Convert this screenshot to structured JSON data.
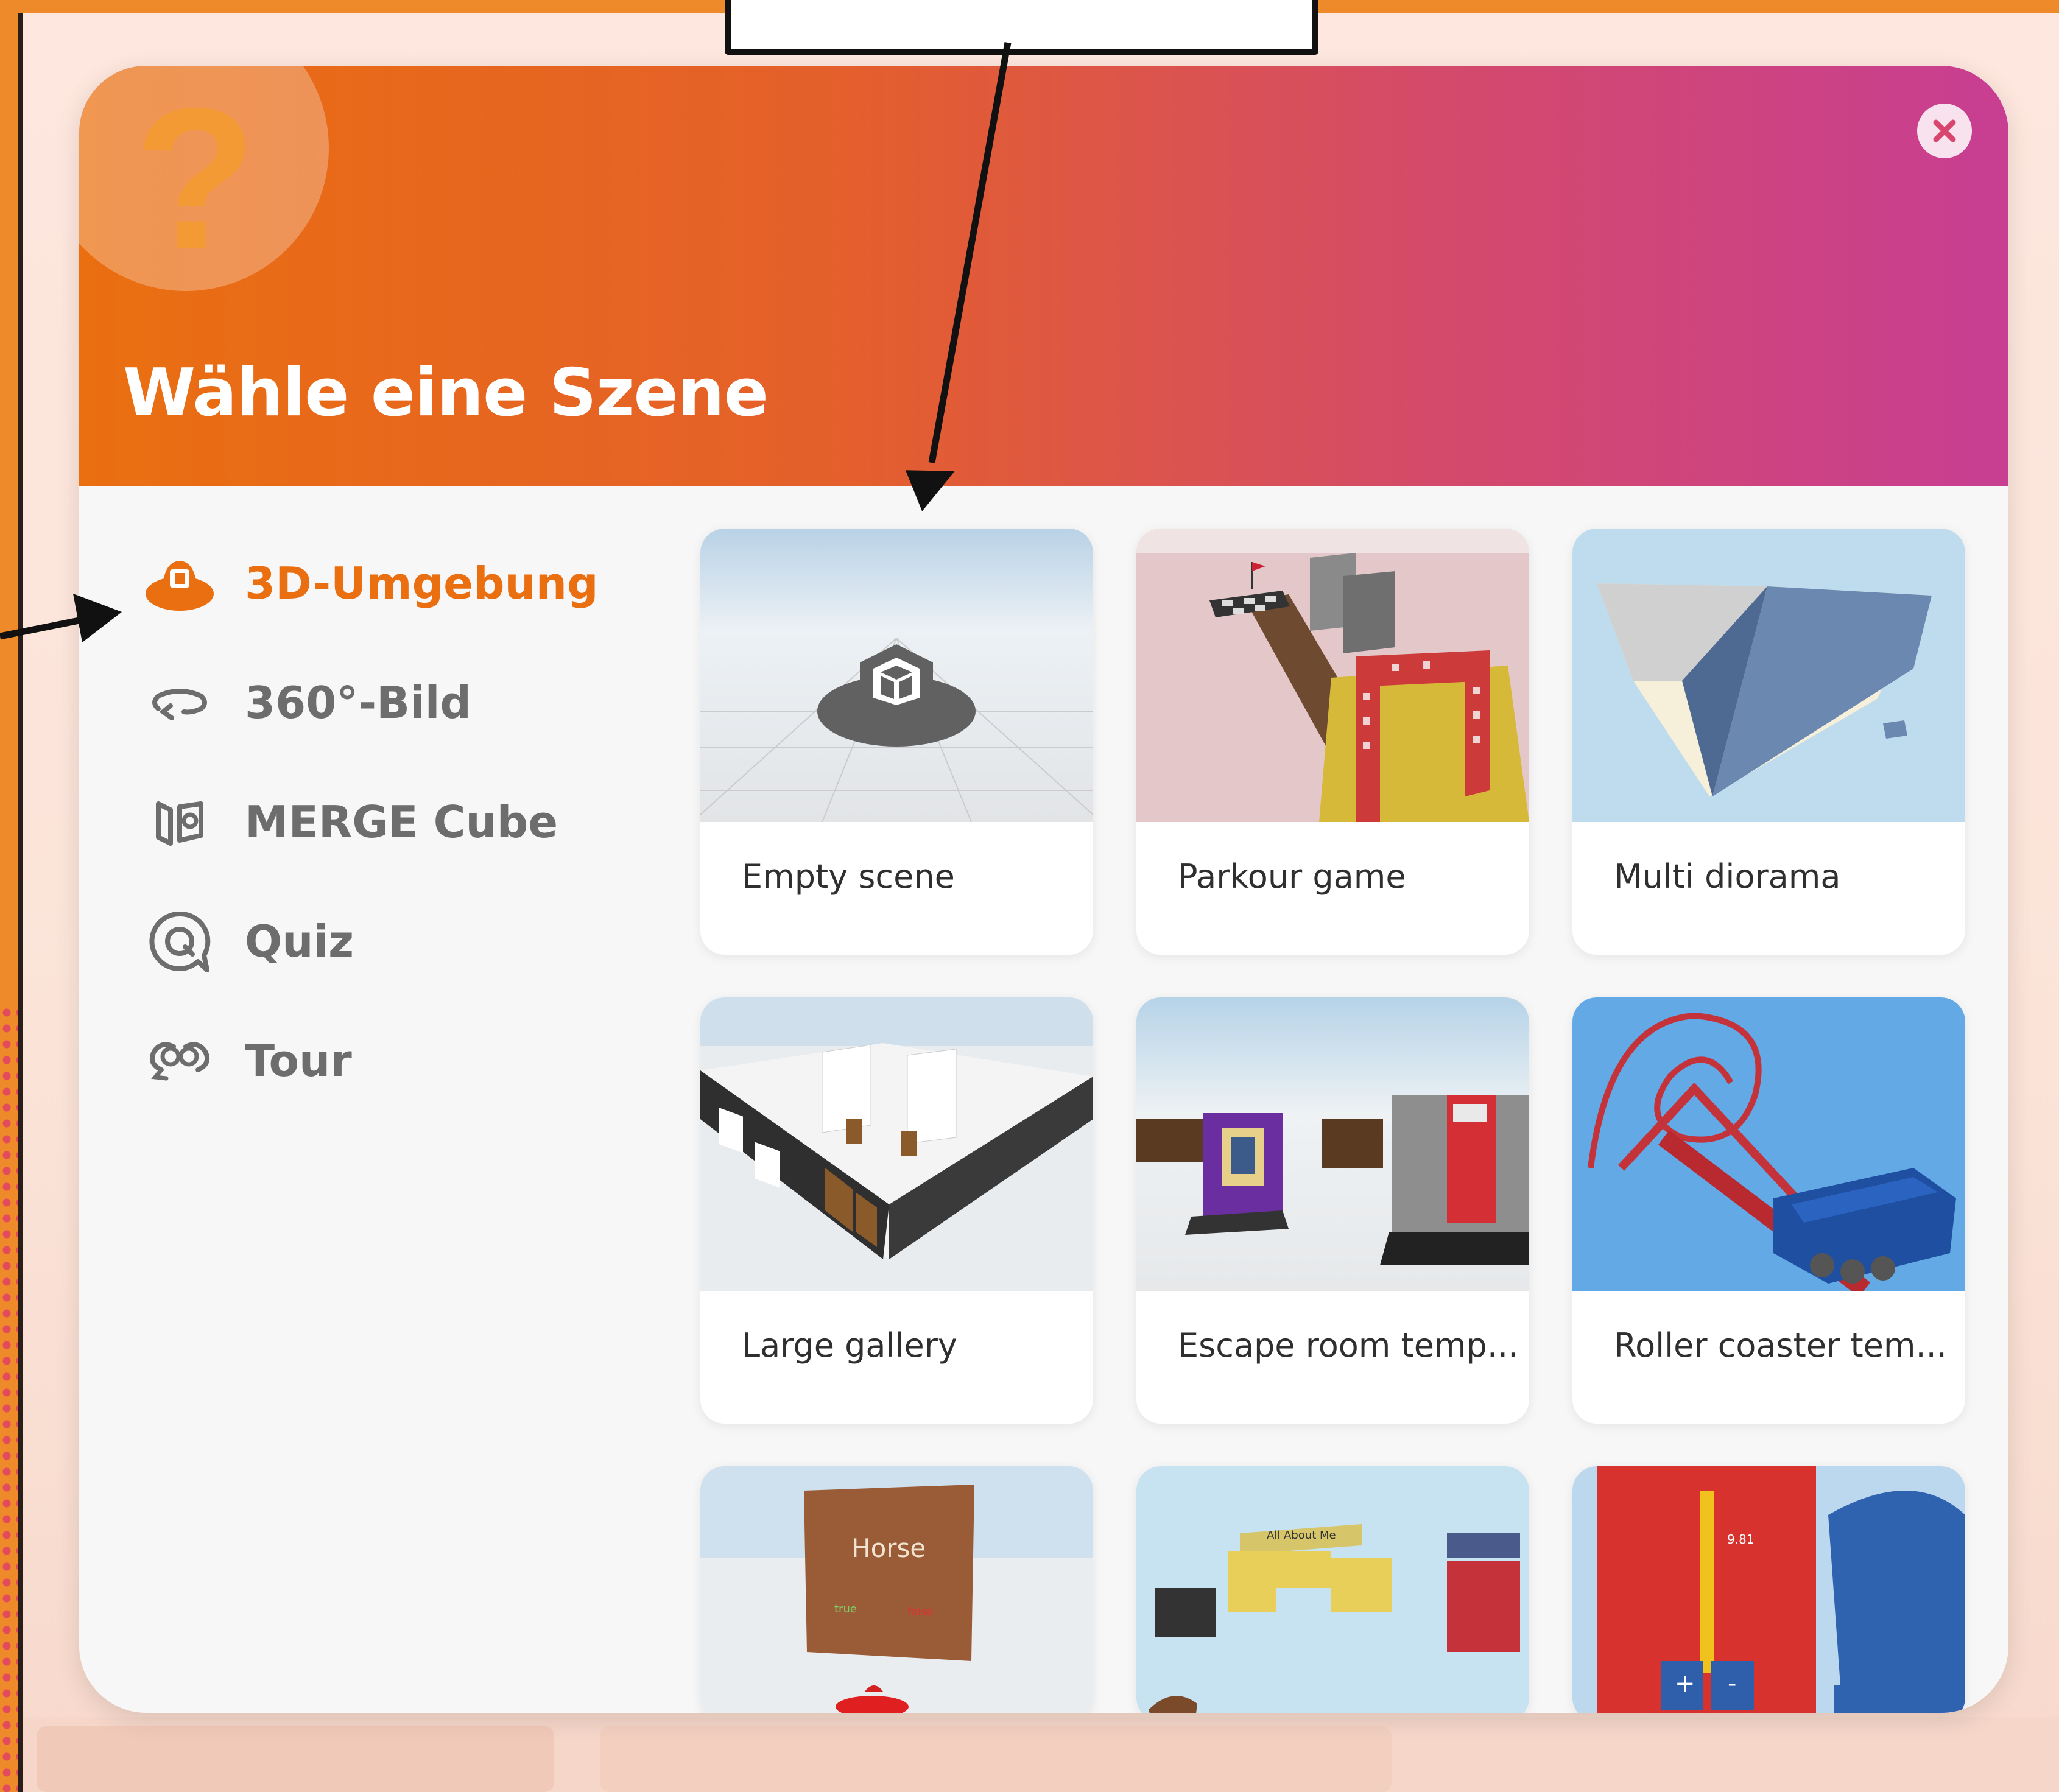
{
  "modal": {
    "title": "Wähle eine Szene",
    "help_mark": "?",
    "accent_color": "#ea6f10",
    "header_gradient": [
      "#ea6f10",
      "#c83e92"
    ]
  },
  "sidebar": {
    "items": [
      {
        "label": "3D-Umgebung",
        "icon": "3d-environment-icon",
        "active": true
      },
      {
        "label": "360°-Bild",
        "icon": "360-image-icon",
        "active": false
      },
      {
        "label": "MERGE Cube",
        "icon": "merge-cube-icon",
        "active": false
      },
      {
        "label": "Quiz",
        "icon": "quiz-icon",
        "active": false
      },
      {
        "label": "Tour",
        "icon": "tour-icon",
        "active": false
      }
    ]
  },
  "scenes": [
    {
      "label": "Empty scene"
    },
    {
      "label": "Parkour game"
    },
    {
      "label": "Multi diorama"
    },
    {
      "label": "Large gallery"
    },
    {
      "label": "Escape room temp..."
    },
    {
      "label": "Roller coaster tem..."
    },
    {
      "label": "",
      "thumb_text": "Horse"
    },
    {
      "label": "",
      "thumb_text": "All About Me"
    },
    {
      "label": "",
      "thumb_text": "9.81"
    }
  ]
}
